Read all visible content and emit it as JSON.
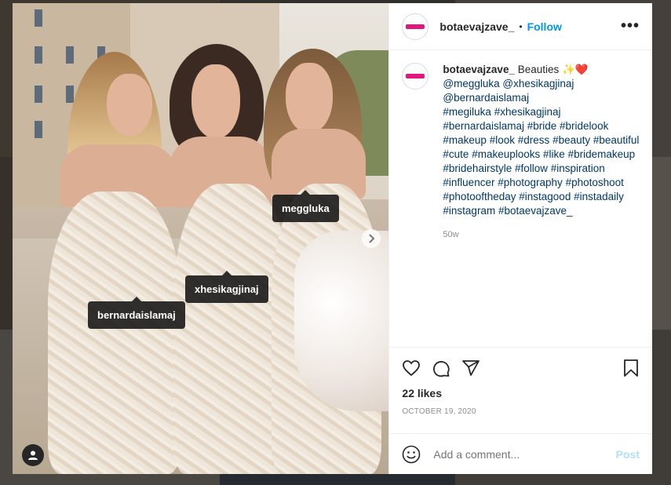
{
  "post": {
    "username": "botaevajzave_",
    "follow_label": "Follow",
    "separator": "•",
    "more_label": "•••",
    "caption_text": "Beauties",
    "caption_emoji": "✨❤️",
    "caption_mentions": [
      "@meggluka",
      "@xhesikagjinaj",
      "@bernardaislamaj"
    ],
    "caption_hashtags": [
      "#megiluka",
      "#xhesikagjinaj",
      "#bernardaislamaj",
      "#bride",
      "#bridelook",
      "#makeup",
      "#look",
      "#dress",
      "#beauty",
      "#beautiful",
      "#cute",
      "#makeuplooks",
      "#like",
      "#bridemakeup",
      "#bridehairstyle",
      "#follow",
      "#inspiration",
      "#influencer",
      "#photography",
      "#photoshoot",
      "#photooftheday",
      "#instagood",
      "#instadaily",
      "#instagram",
      "#botaevajzave_"
    ],
    "caption_age": "50w",
    "likes": "22 likes",
    "date": "OCTOBER 19, 2020",
    "comment_placeholder": "Add a comment...",
    "post_label": "Post"
  },
  "photo_tags": {
    "tag1": "meggluka",
    "tag2": "xhesikagjinaj",
    "tag3": "bernardaislamaj"
  },
  "icons": {
    "like": "heart-icon",
    "comment": "comment-icon",
    "share": "paper-plane-icon",
    "save": "bookmark-icon",
    "emoji": "emoji-icon",
    "next": "chevron-right-icon",
    "user_tags": "user-icon"
  },
  "colors": {
    "accent": "#0095f6",
    "post_disabled": "#b2dffc",
    "avatar_brand": "#e0177c"
  }
}
